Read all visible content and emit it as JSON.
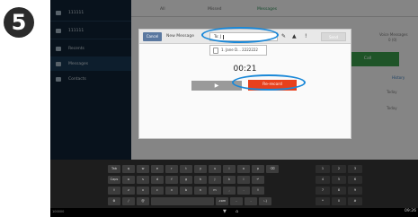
{
  "step_number": "5",
  "sidebar": {
    "items": [
      {
        "label": "111111"
      },
      {
        "label": "111111"
      },
      {
        "label": "Recents"
      },
      {
        "label": "Messages"
      },
      {
        "label": "Contacts"
      }
    ]
  },
  "tabs": [
    {
      "label": "All"
    },
    {
      "label": "Missed"
    },
    {
      "label": "Messages"
    }
  ],
  "background": {
    "voicemail_label": "Voice Messages",
    "voicemail_count": "0 (0)",
    "call_button": "Call",
    "history_label": "History",
    "meta_1": "Today",
    "meta_2": "Today"
  },
  "dialog": {
    "cancel_label": "Cancel",
    "title": "New Message",
    "to_value": "To: J",
    "send_label": "Send",
    "suggestion": "1. Jane D... 2222222",
    "timer": "00:21",
    "play_icon": "▶",
    "rerecord_label": "Re-record"
  },
  "keyboard": {
    "row1": [
      "Tab",
      "q",
      "w",
      "e",
      "r",
      "t",
      "y",
      "u",
      "i",
      "o",
      "p",
      "⌫"
    ],
    "row2": [
      "Caps",
      "a",
      "s",
      "d",
      "f",
      "g",
      "h",
      "j",
      "k",
      "l",
      "↵"
    ],
    "row3": [
      "⇧",
      "z",
      "x",
      "c",
      "v",
      "b",
      "n",
      "m",
      ",",
      ".",
      "⇧"
    ],
    "row4": [
      "⚙",
      "/",
      "@",
      " ",
      ".com",
      "-",
      ".",
      ":-)"
    ],
    "numpad": [
      "1",
      "2",
      "3",
      "4",
      "5",
      "6",
      "7",
      "8",
      "9",
      "*",
      "0",
      "#"
    ]
  },
  "status": {
    "clock": "09:26",
    "left_text": "100000"
  },
  "colors": {
    "accent_highlight": "#1a88d8",
    "rerecord": "#e8401c",
    "call": "#3a9a4a"
  }
}
